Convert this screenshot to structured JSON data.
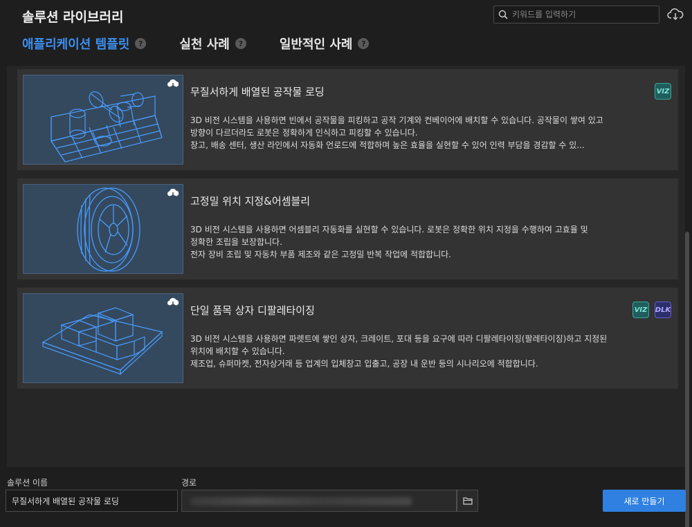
{
  "app": {
    "title": "솔루션 라이브러리"
  },
  "search": {
    "placeholder": "키워드를 입력하기"
  },
  "tabs": [
    {
      "label": "애플리케이션 템플릿",
      "active": true
    },
    {
      "label": "실천 사례",
      "active": false
    },
    {
      "label": "일반적인 사례",
      "active": false
    }
  ],
  "help_badge": "?",
  "cards": [
    {
      "title": "무질서하게 배열된 공작물 로딩",
      "desc": [
        "3D 비전 시스템을 사용하면 빈에서 공작물을 피킹하고 공작 기계와 컨베이어에 배치할 수 있습니다. 공작물이 쌓여 있고",
        "방향이 다르더라도 로봇은 정확하게 인식하고 피킹할 수 있습니다.",
        "창고, 배송 센터, 생산 라인에서 자동화 언로드에 적합하며 높은 효율을 실현할 수 있어 인력 부담을 경감할 수 있..."
      ],
      "badges": [
        "VIZ"
      ],
      "thumb_icon": "cylinders-in-bin"
    },
    {
      "title": "고정밀 위치 지정&어셈블리",
      "desc": [
        "3D 비전 시스템을 사용하면 어셈블리 자동화를 실현할 수 있습니다. 로봇은 정확한 위치 지정을 수행하여 고효율 및",
        "정확한 조립을 보장합니다.",
        "전자 장비 조립 및 자동차 부품 제조와 같은 고정밀 반복 작업에 적합합니다."
      ],
      "badges": [],
      "thumb_icon": "tire-wheel"
    },
    {
      "title": "단일 품목 상자 디팔레타이징",
      "desc": [
        "3D 비전 시스템을 사용하면 파렛트에 쌓인 상자, 크레이트, 포대 등을 요구에 따라 디팔레타이징(팔레타이징)하고 지정된",
        "위치에 배치할 수 있습니다.",
        "제조업, 슈퍼마켓, 전자상거래 등 업계의 입체창고 입출고, 공장 내 운반 등의 시나리오에 적합합니다."
      ],
      "badges": [
        "VIZ",
        "DLK"
      ],
      "thumb_icon": "boxes-on-pallet"
    }
  ],
  "bottom": {
    "name_label": "솔루션 이름",
    "name_value": "무질서하게 배열된 공작물 로딩",
    "path_label": "경로",
    "create_label": "새로 만들기"
  },
  "colors": {
    "accent": "#2f80e0",
    "tab_active": "#3d8ff0",
    "line_art": "#4a9cff"
  }
}
